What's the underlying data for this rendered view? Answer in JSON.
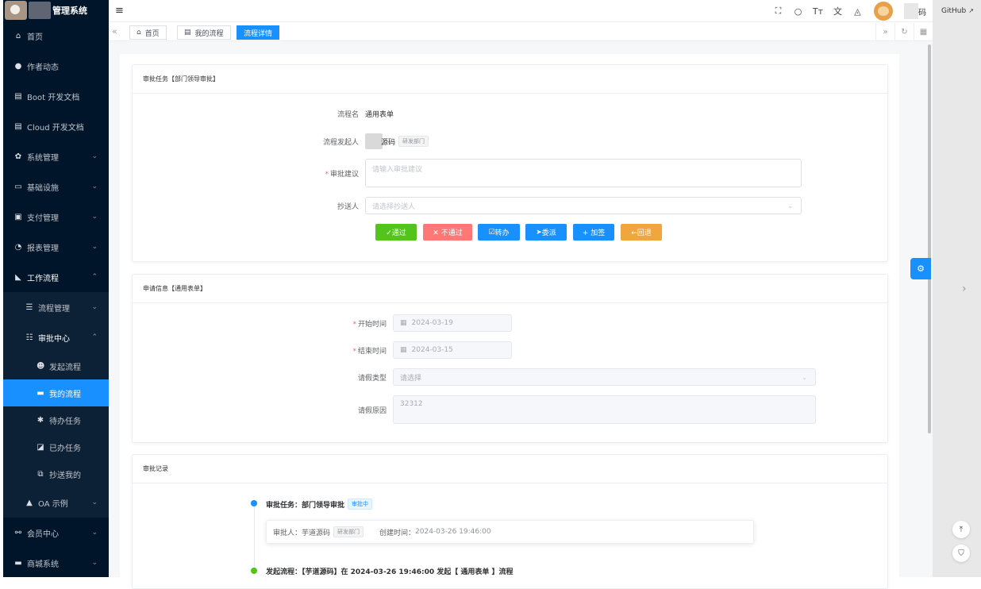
{
  "app": {
    "title": "管理系统"
  },
  "sidebar": {
    "items": [
      {
        "label": "首页",
        "icon": "home-icon"
      },
      {
        "label": "作者动态",
        "icon": "user-icon"
      },
      {
        "label": "Boot 开发文档",
        "icon": "document-icon"
      },
      {
        "label": "Cloud 开发文档",
        "icon": "document-icon"
      },
      {
        "label": "系统管理",
        "icon": "gear-icon"
      },
      {
        "label": "基础设施",
        "icon": "monitor-icon"
      },
      {
        "label": "支付管理",
        "icon": "payment-icon"
      },
      {
        "label": "报表管理",
        "icon": "chart-icon"
      },
      {
        "label": "工作流程",
        "icon": "workflow-icon"
      },
      {
        "label": "流程管理",
        "icon": "list-icon"
      },
      {
        "label": "审批中心",
        "icon": "server-icon"
      },
      {
        "label": "发起流程",
        "icon": "smile-icon"
      },
      {
        "label": "我的流程",
        "icon": "book-icon"
      },
      {
        "label": "待办任务",
        "icon": "puzzle-icon"
      },
      {
        "label": "已办任务",
        "icon": "done-icon"
      },
      {
        "label": "抄送我的",
        "icon": "copy-icon"
      },
      {
        "label": "OA 示例",
        "icon": "oa-icon"
      },
      {
        "label": "会员中心",
        "icon": "bike-icon"
      },
      {
        "label": "商城系统",
        "icon": "shop-icon"
      }
    ]
  },
  "header": {
    "user_name": "码",
    "github": "GitHub"
  },
  "tabs": [
    {
      "label": "首页"
    },
    {
      "label": "我的流程"
    },
    {
      "label": "流程详情"
    }
  ],
  "approval_card": {
    "title": "审批任务【部门领导审批】",
    "process_name_label": "流程名",
    "process_name": "通用表单",
    "initiator_label": "流程发起人",
    "initiator_name": "源码",
    "initiator_dept": "研发部门",
    "comment_label": "审批建议",
    "comment_placeholder": "请输入审批建议",
    "cc_label": "抄送人",
    "cc_placeholder": "请选择抄送人",
    "buttons": {
      "approve": "✓通过",
      "reject": "✕ 不通过",
      "transfer": "转办",
      "delegate": "委派",
      "add_sign": "+ 加签",
      "back": "←回退"
    }
  },
  "form_card": {
    "title": "申请信息【通用表单】",
    "start_label": "开始时间",
    "start_value": "2024-03-19",
    "end_label": "结束时间",
    "end_value": "2024-03-15",
    "type_label": "请假类型",
    "type_placeholder": "请选择",
    "reason_label": "请假原因",
    "reason_value": "32312"
  },
  "record_card": {
    "title": "审批记录",
    "task_title": "审批任务：部门领导审批",
    "task_status": "审批中",
    "approver_label": "审批人：芋道源码",
    "approver_dept": "研发部门",
    "created_label": "创建时间：",
    "created_value": "2024-03-26 19:46:00",
    "start_record": "发起流程：【芋道源码】在 2024-03-26 19:46:00 发起【 通用表单 】流程"
  },
  "colors": {
    "sidebar_bg": "#001529",
    "primary": "#1890ff",
    "success": "#52c41a",
    "danger": "#ff7875",
    "warning": "#f0a53e"
  }
}
